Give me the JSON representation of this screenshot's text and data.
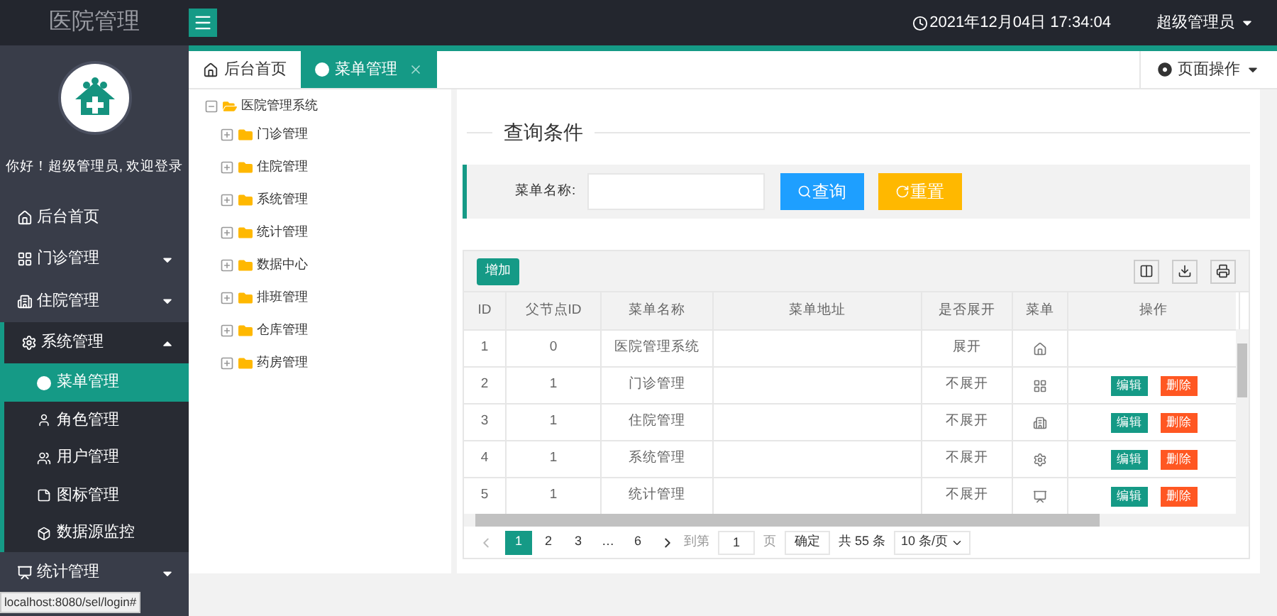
{
  "header": {
    "title": "医院管理",
    "datetime": "2021年12月04日 17:34:04",
    "user": "超级管理员"
  },
  "sidebar": {
    "greeting": "你好！超级管理员, 欢迎登录",
    "items": [
      {
        "label": "后台首页",
        "selected": false
      },
      {
        "label": "门诊管理",
        "selected": false,
        "expanded": false
      },
      {
        "label": "住院管理",
        "selected": false,
        "expanded": false
      },
      {
        "label": "系统管理",
        "selected": false,
        "expanded": true,
        "children": [
          {
            "label": "菜单管理",
            "selected": true
          },
          {
            "label": "角色管理",
            "selected": false
          },
          {
            "label": "用户管理",
            "selected": false
          },
          {
            "label": "图标管理",
            "selected": false
          },
          {
            "label": "数据源监控",
            "selected": false
          }
        ]
      },
      {
        "label": "统计管理",
        "selected": false,
        "expanded": false
      }
    ]
  },
  "tabs": [
    {
      "label": "后台首页",
      "selected": false
    },
    {
      "label": "菜单管理",
      "selected": true
    }
  ],
  "page_actions": "页面操作",
  "tree": {
    "label": "医院管理系统",
    "expanded": true,
    "children": [
      {
        "label": "门诊管理",
        "expanded": false
      },
      {
        "label": "住院管理",
        "expanded": false
      },
      {
        "label": "系统管理",
        "expanded": false
      },
      {
        "label": "统计管理",
        "expanded": false
      },
      {
        "label": "数据中心",
        "expanded": false
      },
      {
        "label": "排班管理",
        "expanded": false
      },
      {
        "label": "仓库管理",
        "expanded": false
      },
      {
        "label": "药房管理",
        "expanded": false
      }
    ]
  },
  "query": {
    "title": "查询条件",
    "field_label": "菜单名称:",
    "buttons": [
      {
        "label": "查询",
        "kind": "search"
      },
      {
        "label": "重置",
        "kind": "reset"
      }
    ]
  },
  "table": {
    "add_button": "增加",
    "columns": [
      "ID",
      "父节点ID",
      "菜单名称",
      "菜单地址",
      "是否展开",
      "菜单",
      "操作"
    ],
    "rows": [
      {
        "id": "1",
        "parent_id": "0",
        "name": "医院管理系统",
        "expand": "展开"
      },
      {
        "id": "2",
        "parent_id": "1",
        "name": "门诊管理",
        "expand": "不展开",
        "actions": [
          "编辑",
          "删除"
        ]
      },
      {
        "id": "3",
        "parent_id": "1",
        "name": "住院管理",
        "expand": "不展开",
        "actions": [
          "编辑",
          "删除"
        ]
      },
      {
        "id": "4",
        "parent_id": "1",
        "name": "系统管理",
        "expand": "不展开",
        "actions": [
          "编辑",
          "删除"
        ]
      },
      {
        "id": "5",
        "parent_id": "1",
        "name": "统计管理",
        "expand": "不展开",
        "actions": [
          "编辑",
          "删除"
        ]
      }
    ]
  },
  "pagination": {
    "pages": [
      {
        "label": "1",
        "selected": true
      },
      {
        "label": "2",
        "selected": false
      },
      {
        "label": "3",
        "selected": false
      },
      {
        "label": "…",
        "selected": false
      },
      {
        "label": "6",
        "selected": false
      }
    ],
    "goto_label": "到第",
    "goto_value": "1",
    "page_unit": "页",
    "confirm": "确定",
    "total": "共 55 条",
    "page_size": "10 条/页"
  },
  "status_url": "localhost:8080/sel/login#"
}
